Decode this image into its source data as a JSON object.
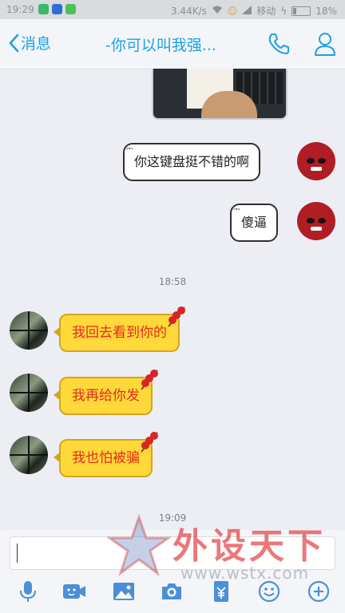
{
  "status_bar": {
    "time": "19:29",
    "network_speed": "3.44K/s",
    "carrier": "移动",
    "battery": "18%"
  },
  "header": {
    "back_label": "消息",
    "title": "-你可以叫我强..."
  },
  "messages": [
    {
      "direction": "out",
      "type": "image"
    },
    {
      "direction": "out",
      "text": "你这键盘挺不错的啊"
    },
    {
      "direction": "out",
      "text": "傻逼"
    },
    {
      "type": "timestamp",
      "text": "18:58"
    },
    {
      "direction": "in",
      "text": "我回去看到你的"
    },
    {
      "direction": "in",
      "text": "我再给你发"
    },
    {
      "direction": "in",
      "text": "我也怕被骗"
    },
    {
      "type": "timestamp",
      "text": "19:09"
    }
  ],
  "input": {
    "value": ""
  },
  "toolbar": {
    "icons": [
      "microphone-icon",
      "video-icon",
      "image-icon",
      "camera-icon",
      "red-packet-icon",
      "emoji-icon",
      "plus-icon"
    ]
  },
  "watermark": {
    "text": "外设天下",
    "url": "www.wstx.com"
  },
  "colors": {
    "accent": "#1da1e5",
    "incoming_bubble": "#ffd83a",
    "incoming_text": "#e22d1e"
  }
}
